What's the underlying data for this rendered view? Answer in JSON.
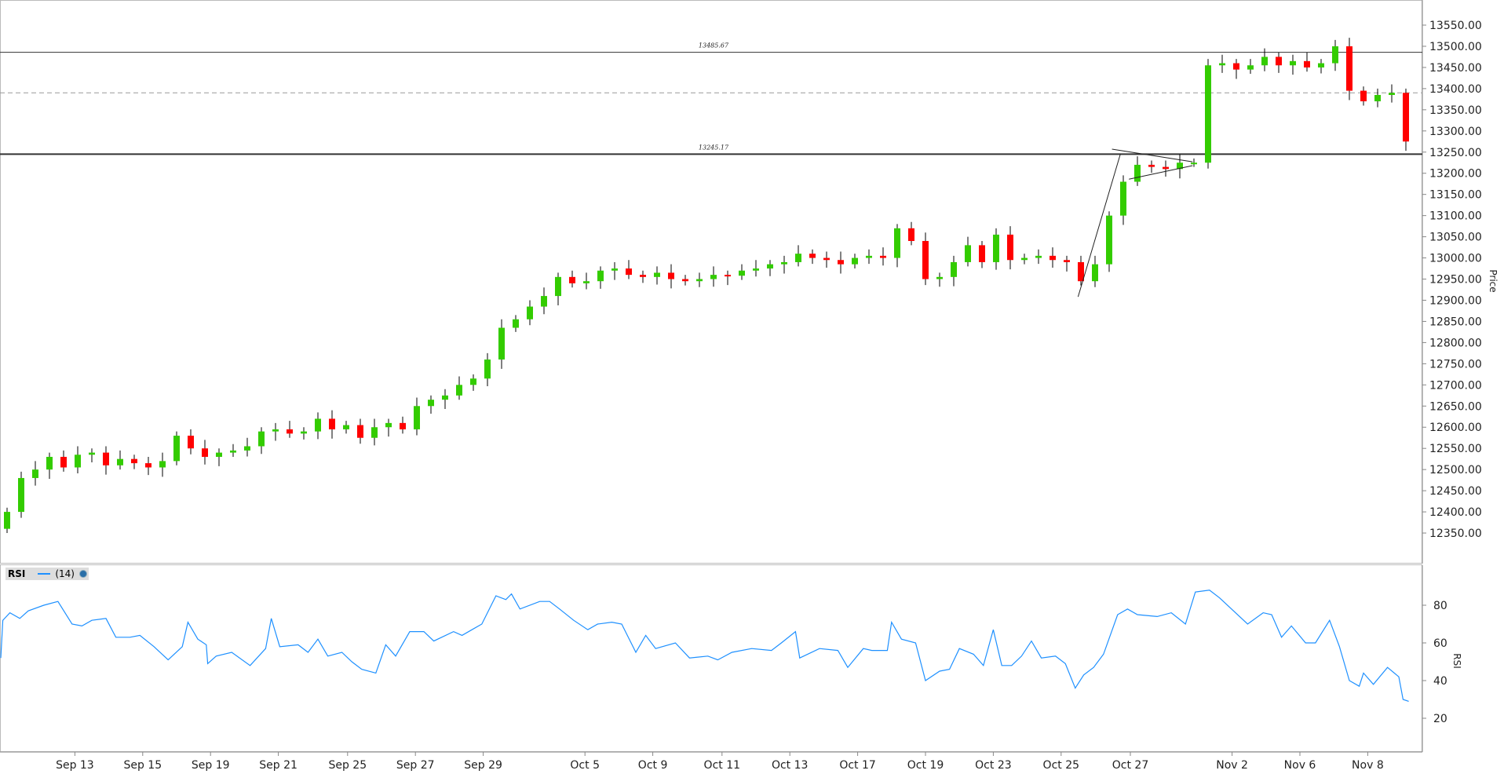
{
  "chart_data": {
    "type": "candlestick",
    "price_axis": {
      "label": "Price",
      "min": 12350,
      "max": 13550,
      "step": 50,
      "decimals": 2
    },
    "colors": {
      "up": "#33cc00",
      "down": "#ff0000",
      "rsi": "#1e90ff"
    },
    "dates": [
      {
        "label": "Sep 13",
        "t": 4.8
      },
      {
        "label": "Sep 15",
        "t": 9.6
      },
      {
        "label": "Sep 19",
        "t": 14.4
      },
      {
        "label": "Sep 21",
        "t": 19.2
      },
      {
        "label": "Sep 25",
        "t": 24.1
      },
      {
        "label": "Sep 27",
        "t": 28.9
      },
      {
        "label": "Sep 29",
        "t": 33.7
      },
      {
        "label": "Oct 5",
        "t": 40.9
      },
      {
        "label": "Oct 9",
        "t": 45.7
      },
      {
        "label": "Oct 11",
        "t": 50.6
      },
      {
        "label": "Oct 13",
        "t": 55.4
      },
      {
        "label": "Oct 17",
        "t": 60.2
      },
      {
        "label": "Oct 19",
        "t": 65
      },
      {
        "label": "Oct 23",
        "t": 69.8
      },
      {
        "label": "Oct 25",
        "t": 74.6
      },
      {
        "label": "Oct 27",
        "t": 79.5
      },
      {
        "label": "Nov 2",
        "t": 86.7
      },
      {
        "label": "Nov 6",
        "t": 91.5
      },
      {
        "label": "Nov 8",
        "t": 96.3
      }
    ],
    "first_open": 12360,
    "closes": [
      12400,
      12480,
      12500,
      12530,
      12505,
      12535,
      12540,
      12510,
      12525,
      12515,
      12505,
      12520,
      12580,
      12550,
      12530,
      12540,
      12545,
      12555,
      12590,
      12595,
      12585,
      12590,
      12620,
      12595,
      12605,
      12575,
      12600,
      12610,
      12595,
      12650,
      12665,
      12675,
      12700,
      12715,
      12760,
      12835,
      12855,
      12885,
      12910,
      12955,
      12940,
      12945,
      12970,
      12975,
      12960,
      12955,
      12965,
      12950,
      12945,
      12950,
      12960,
      12958,
      12970,
      12975,
      12985,
      12990,
      13010,
      13000,
      12995,
      12985,
      13000,
      13005,
      13000,
      13070,
      13040,
      12950,
      12955,
      12990,
      13030,
      12990,
      13055,
      12995,
      13000,
      13005,
      12995,
      12990,
      12945,
      12985,
      13100,
      13180,
      13220,
      13215,
      13210,
      13225,
      13225,
      13455,
      13460,
      13445,
      13455,
      13475,
      13455,
      13465,
      13450,
      13460,
      13500,
      13395,
      13370,
      13385,
      13390,
      13275
    ],
    "levels": [
      {
        "price": 13485.67,
        "label": "13485.67",
        "style": "solid"
      },
      {
        "price": 13245.17,
        "label": "13245.17",
        "style": "solid-bold"
      },
      {
        "price": 13390,
        "style": "dashed"
      }
    ],
    "drawings": [
      {
        "from": [
          75.8,
          12908
        ],
        "to": [
          78.8,
          13246
        ]
      },
      {
        "from": [
          78.2,
          13257
        ],
        "to": [
          83.9,
          13227
        ]
      },
      {
        "from": [
          79.4,
          13186
        ],
        "to": [
          83.9,
          13218
        ]
      }
    ],
    "rsi": {
      "title": "RSI",
      "period": "(14)",
      "axis_label": "RSI",
      "ticks": [
        20,
        40,
        60,
        80
      ],
      "points": [
        [
          -0.5,
          52
        ],
        [
          -0.3,
          72
        ],
        [
          0.2,
          76
        ],
        [
          0.9,
          73
        ],
        [
          1.5,
          77
        ],
        [
          2.6,
          80
        ],
        [
          3.6,
          82
        ],
        [
          4.6,
          70
        ],
        [
          5.3,
          69
        ],
        [
          6.0,
          72
        ],
        [
          7.0,
          73
        ],
        [
          7.7,
          63
        ],
        [
          8.7,
          63
        ],
        [
          9.4,
          64
        ],
        [
          10.4,
          58
        ],
        [
          11.4,
          51
        ],
        [
          12.4,
          58
        ],
        [
          12.8,
          71
        ],
        [
          13.5,
          62
        ],
        [
          14.1,
          59
        ],
        [
          14.2,
          49
        ],
        [
          14.8,
          53
        ],
        [
          15.9,
          55
        ],
        [
          17.2,
          48
        ],
        [
          18.3,
          57
        ],
        [
          18.7,
          73
        ],
        [
          19.3,
          58
        ],
        [
          20.6,
          59
        ],
        [
          21.3,
          55
        ],
        [
          22.0,
          62
        ],
        [
          22.7,
          53
        ],
        [
          23.7,
          55
        ],
        [
          24.4,
          50
        ],
        [
          25.1,
          46
        ],
        [
          26.1,
          44
        ],
        [
          26.8,
          59
        ],
        [
          27.5,
          53
        ],
        [
          28.5,
          66
        ],
        [
          29.5,
          66
        ],
        [
          30.2,
          61
        ],
        [
          31.6,
          66
        ],
        [
          32.2,
          64
        ],
        [
          32.9,
          67
        ],
        [
          33.6,
          70
        ],
        [
          34.6,
          85
        ],
        [
          35.3,
          83
        ],
        [
          35.7,
          86
        ],
        [
          36.3,
          78
        ],
        [
          37.7,
          82
        ],
        [
          38.4,
          82
        ],
        [
          39.1,
          78
        ],
        [
          40.1,
          72
        ],
        [
          41.1,
          67
        ],
        [
          41.8,
          70
        ],
        [
          42.8,
          71
        ],
        [
          43.5,
          70
        ],
        [
          44.5,
          55
        ],
        [
          45.2,
          64
        ],
        [
          45.9,
          57
        ],
        [
          47.3,
          60
        ],
        [
          48.3,
          52
        ],
        [
          49.6,
          53
        ],
        [
          50.3,
          51
        ],
        [
          51.3,
          55
        ],
        [
          52.7,
          57
        ],
        [
          54.1,
          56
        ],
        [
          54.8,
          60
        ],
        [
          55.8,
          66
        ],
        [
          56.1,
          52
        ],
        [
          57.5,
          57
        ],
        [
          58.8,
          56
        ],
        [
          59.5,
          47
        ],
        [
          60.6,
          57
        ],
        [
          61.2,
          56
        ],
        [
          62.3,
          56
        ],
        [
          62.6,
          71
        ],
        [
          63.3,
          62
        ],
        [
          64.3,
          60
        ],
        [
          65.0,
          40
        ],
        [
          66.0,
          45
        ],
        [
          66.7,
          46
        ],
        [
          67.4,
          57
        ],
        [
          68.4,
          54
        ],
        [
          69.1,
          48
        ],
        [
          69.8,
          67
        ],
        [
          70.4,
          48
        ],
        [
          71.1,
          48
        ],
        [
          71.8,
          53
        ],
        [
          72.5,
          61
        ],
        [
          73.2,
          52
        ],
        [
          74.2,
          53
        ],
        [
          74.9,
          49
        ],
        [
          75.6,
          36
        ],
        [
          76.2,
          43
        ],
        [
          76.9,
          47
        ],
        [
          77.6,
          54
        ],
        [
          78.6,
          75
        ],
        [
          79.3,
          78
        ],
        [
          80.0,
          75
        ],
        [
          81.4,
          74
        ],
        [
          82.4,
          76
        ],
        [
          83.4,
          70
        ],
        [
          84.1,
          87
        ],
        [
          85.1,
          88
        ],
        [
          85.8,
          84
        ],
        [
          86.8,
          77
        ],
        [
          87.8,
          70
        ],
        [
          88.9,
          76
        ],
        [
          89.5,
          75
        ],
        [
          90.2,
          63
        ],
        [
          90.9,
          69
        ],
        [
          91.9,
          60
        ],
        [
          92.6,
          60
        ],
        [
          93.6,
          72
        ],
        [
          94.3,
          58
        ],
        [
          95.0,
          40
        ],
        [
          95.7,
          37
        ],
        [
          96.0,
          44
        ],
        [
          96.7,
          38
        ],
        [
          97.7,
          47
        ],
        [
          98.5,
          42
        ],
        [
          98.8,
          30
        ],
        [
          99.2,
          29
        ]
      ]
    }
  }
}
